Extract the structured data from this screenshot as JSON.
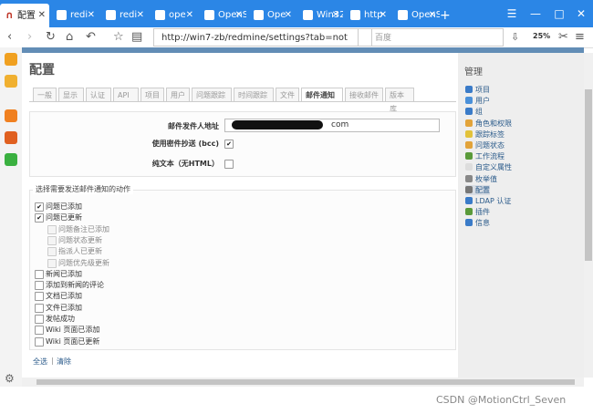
{
  "browser": {
    "tabs": [
      {
        "title": "配置",
        "active": true
      },
      {
        "title": "redi"
      },
      {
        "title": "redi"
      },
      {
        "title": "ope"
      },
      {
        "title": "OpenS"
      },
      {
        "title": "Ope"
      },
      {
        "title": "Win32,"
      },
      {
        "title": "http"
      },
      {
        "title": "OpenS"
      }
    ],
    "new_tab": "+",
    "window_controls": [
      "☰",
      "—",
      "□",
      "✕"
    ],
    "url": "http://win7-zb/redmine/settings?tab=not",
    "search_placeholder": "百度",
    "zoom": "25%"
  },
  "page": {
    "title": "配置",
    "settings_tabs": [
      "一般",
      "显示",
      "认证",
      "API",
      "项目",
      "用户",
      "问题跟踪",
      "时间跟踪",
      "文件",
      "邮件通知",
      "接收邮件",
      "版本库"
    ],
    "selected_tab": "邮件通知",
    "form": {
      "sender_label": "邮件发件人地址",
      "sender_value_visible": "com",
      "bcc_label": "使用密件抄送 (bcc)",
      "bcc_checked": true,
      "plain_label": "纯文本（无HTML）",
      "plain_checked": false
    },
    "events_legend": "选择需要发送邮件通知的动作",
    "events": [
      {
        "label": "问题已添加",
        "checked": true,
        "indent": false,
        "disabled": false
      },
      {
        "label": "问题已更新",
        "checked": true,
        "indent": false,
        "disabled": false
      },
      {
        "label": "问题备注已添加",
        "checked": false,
        "indent": true,
        "disabled": true
      },
      {
        "label": "问题状态更新",
        "checked": false,
        "indent": true,
        "disabled": true
      },
      {
        "label": "指派人已更新",
        "checked": false,
        "indent": true,
        "disabled": true
      },
      {
        "label": "问题优先级更新",
        "checked": false,
        "indent": true,
        "disabled": true
      },
      {
        "label": "新闻已添加",
        "checked": false,
        "indent": false,
        "disabled": false
      },
      {
        "label": "添加到新闻的评论",
        "checked": false,
        "indent": false,
        "disabled": false
      },
      {
        "label": "文档已添加",
        "checked": false,
        "indent": false,
        "disabled": false
      },
      {
        "label": "文件已添加",
        "checked": false,
        "indent": false,
        "disabled": false
      },
      {
        "label": "发帖成功",
        "checked": false,
        "indent": false,
        "disabled": false
      },
      {
        "label": "Wiki 页面已添加",
        "checked": false,
        "indent": false,
        "disabled": false
      },
      {
        "label": "Wiki 页面已更新",
        "checked": false,
        "indent": false,
        "disabled": false
      }
    ],
    "select_all": "全选",
    "select_sep": "|",
    "select_none": "清除"
  },
  "sidebar": {
    "title": "管理",
    "items": [
      {
        "label": "项目",
        "color": "#3a7bc8"
      },
      {
        "label": "用户",
        "color": "#4a90d9"
      },
      {
        "label": "组",
        "color": "#3a7bc8"
      },
      {
        "label": "角色和权限",
        "color": "#e2a33a"
      },
      {
        "label": "跟踪标签",
        "color": "#e2c23a"
      },
      {
        "label": "问题状态",
        "color": "#e2a33a"
      },
      {
        "label": "工作流程",
        "color": "#5a9a3a"
      },
      {
        "label": "自定义属性",
        "color": "#dddddd"
      },
      {
        "label": "枚举值",
        "color": "#888888"
      },
      {
        "label": "配置",
        "color": "#777777",
        "selected": true
      },
      {
        "label": "LDAP 认证",
        "color": "#3a7bc8"
      },
      {
        "label": "插件",
        "color": "#5a9a3a"
      },
      {
        "label": "信息",
        "color": "#3a7bc8"
      }
    ]
  },
  "watermark": "CSDN @MotionCtrl_Seven"
}
